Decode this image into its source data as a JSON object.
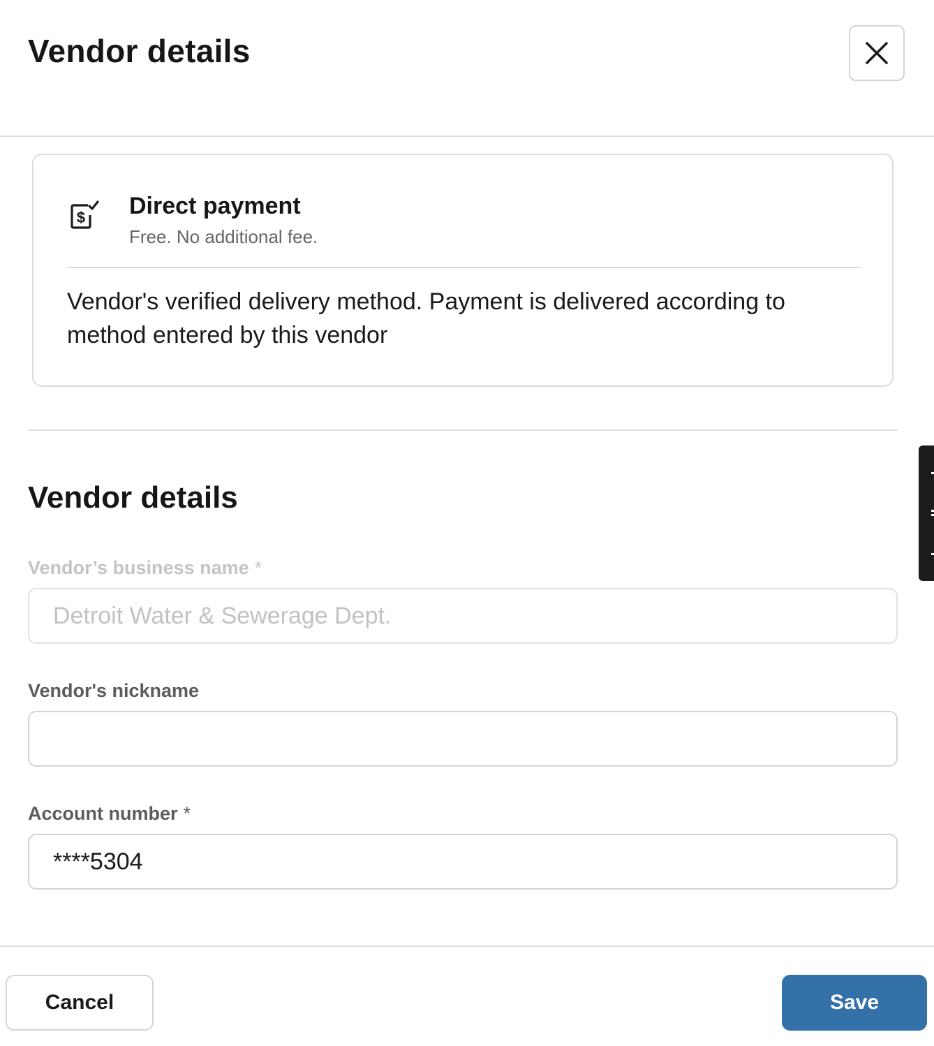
{
  "header": {
    "title": "Vendor details",
    "close_icon": "close-icon"
  },
  "payment_card": {
    "icon": "dollar-document-check-icon",
    "title": "Direct payment",
    "subtitle": "Free. No additional fee.",
    "description": "Vendor's verified delivery method. Payment is delivered according to method entered by this vendor"
  },
  "vendor_section": {
    "title": "Vendor details",
    "fields": {
      "business_name": {
        "label": "Vendor’s business name",
        "required_mark": "*",
        "value": "",
        "placeholder": "Detroit Water & Sewerage Dept.",
        "disabled": true
      },
      "nickname": {
        "label": "Vendor's nickname",
        "value": "",
        "placeholder": ""
      },
      "account_number": {
        "label": "Account number",
        "required_mark": "*",
        "value": "****5304"
      }
    }
  },
  "footer": {
    "cancel_label": "Cancel",
    "save_label": "Save"
  },
  "colors": {
    "primary_button": "#3371a8",
    "border": "#d4d4d4",
    "disabled_text": "#c2c2c2"
  }
}
